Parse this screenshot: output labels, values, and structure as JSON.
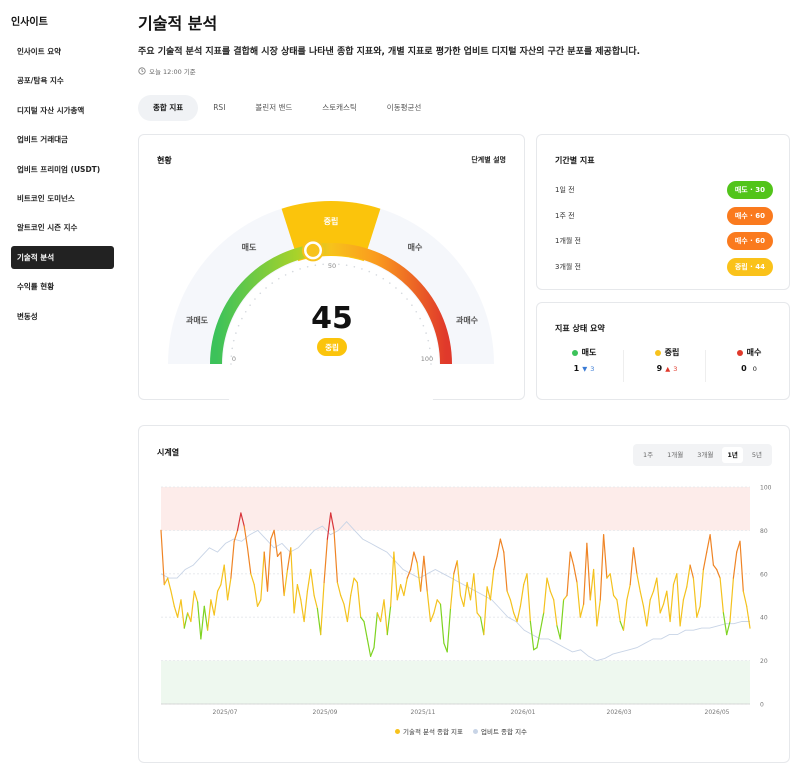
{
  "sidebar": {
    "title": "인사이트",
    "items": [
      {
        "label": "인사이트 요약"
      },
      {
        "label": "공포/탐욕 지수"
      },
      {
        "label": "디지털 자산 시가총액"
      },
      {
        "label": "업비트 거래대금"
      },
      {
        "label": "업비트 프리미엄 (USDT)"
      },
      {
        "label": "비트코인 도미넌스"
      },
      {
        "label": "알트코인 시즌 지수"
      },
      {
        "label": "기술적 분석"
      },
      {
        "label": "수익률 현황"
      },
      {
        "label": "변동성"
      }
    ],
    "active_index": 7
  },
  "header": {
    "title": "기술적 분석",
    "description": "주요 기술적 분석 지표를 결합해 시장 상태를 나타낸 종합 지표와, 개별 지표로 평가한 업비트 디지털 자산의 구간 분포를 제공합니다.",
    "timestamp": "오늘 12:00 기준"
  },
  "tabs": [
    {
      "label": "종합 지표"
    },
    {
      "label": "RSI"
    },
    {
      "label": "볼린저 밴드"
    },
    {
      "label": "스토캐스틱"
    },
    {
      "label": "이동평균선"
    }
  ],
  "gauge": {
    "title": "현황",
    "help_link": "단계별 설명",
    "value": "45",
    "status": "중립",
    "zone_labels": {
      "extreme_sell": "과매도",
      "sell": "매도",
      "neutral": "중립",
      "buy": "매수",
      "extreme_buy": "과매수"
    },
    "tick_min": "0",
    "tick_mid": "50",
    "tick_max": "100",
    "value_fraction": 0.45
  },
  "period": {
    "title": "기간별 지표",
    "rows": [
      {
        "label": "1일 전",
        "badge": "매도 · 30",
        "color": "#52c41a"
      },
      {
        "label": "1주 전",
        "badge": "매수 · 60",
        "color": "#fa7a1e"
      },
      {
        "label": "1개월 전",
        "badge": "매수 · 60",
        "color": "#fa7a1e"
      },
      {
        "label": "3개월 전",
        "badge": "중립 · 44",
        "color": "#fac21a"
      }
    ]
  },
  "summary": {
    "title": "지표 상태 요약",
    "columns": [
      {
        "label": "매도",
        "color": "#3cc25a",
        "count": "1",
        "arrow": "▼",
        "change": "3",
        "arrow_color": "#3a7bd5"
      },
      {
        "label": "중립",
        "color": "#f7c21c",
        "count": "9",
        "arrow": "▲",
        "change": "3",
        "arrow_color": "#e0392b"
      },
      {
        "label": "매수",
        "color": "#e0392b",
        "count": "0",
        "arrow": "",
        "change": "0",
        "arrow_color": "#111"
      }
    ]
  },
  "timeseries": {
    "title": "시계열",
    "ranges": [
      {
        "label": "1주"
      },
      {
        "label": "1개월"
      },
      {
        "label": "3개월"
      },
      {
        "label": "1년",
        "active": true
      },
      {
        "label": "5년"
      }
    ],
    "legend": [
      {
        "label": "기술적 분석 종합 지표",
        "color": "#f7c21c"
      },
      {
        "label": "업비트 종합 지수",
        "color": "#c8d4e6"
      }
    ]
  },
  "chart_data": {
    "type": "line",
    "ylim": [
      0,
      100
    ],
    "y_ticks": [
      "0",
      "20",
      "40",
      "60",
      "80",
      "100"
    ],
    "x_ticks": [
      "2025/07",
      "2025/09",
      "2025/11",
      "2026/01",
      "2026/03",
      "2026/05"
    ],
    "bands": [
      {
        "from": 80,
        "to": 100,
        "color": "#fdecea"
      },
      {
        "from": 0,
        "to": 20,
        "color": "#eef8ef"
      }
    ],
    "series": [
      {
        "name": "기술적 분석 종합 지표",
        "values": [
          80,
          55,
          58,
          52,
          45,
          40,
          48,
          35,
          42,
          38,
          52,
          47,
          30,
          45,
          34,
          48,
          41,
          52,
          55,
          64,
          48,
          58,
          75,
          80,
          88,
          82,
          72,
          60,
          55,
          45,
          48,
          70,
          52,
          76,
          80,
          68,
          70,
          50,
          62,
          72,
          42,
          55,
          48,
          38,
          52,
          62,
          50,
          44,
          32,
          56,
          76,
          88,
          80,
          56,
          50,
          46,
          38,
          50,
          58,
          56,
          40,
          38,
          30,
          22,
          26,
          42,
          38,
          48,
          32,
          45,
          70,
          48,
          55,
          50,
          58,
          62,
          70,
          65,
          52,
          68,
          52,
          38,
          42,
          48,
          46,
          28,
          24,
          44,
          60,
          66,
          50,
          45,
          56,
          48,
          60,
          42,
          40,
          32,
          54,
          48,
          62,
          68,
          76,
          70,
          52,
          48,
          42,
          38,
          45,
          55,
          60,
          38,
          25,
          26,
          34,
          42,
          58,
          52,
          48,
          36,
          30,
          48,
          50,
          70,
          64,
          56,
          40,
          46,
          74,
          48,
          62,
          36,
          48,
          78,
          58,
          60,
          50,
          48,
          38,
          34,
          48,
          55,
          72,
          60,
          52,
          45,
          36,
          48,
          52,
          58,
          42,
          46,
          52,
          38,
          55,
          60,
          36,
          48,
          54,
          64,
          58,
          40,
          45,
          62,
          70,
          78,
          64,
          62,
          58,
          42,
          32,
          38,
          58,
          70,
          75,
          52,
          45,
          35
        ],
        "color": "#f7c21c"
      },
      {
        "name": "업비트 종합 지수",
        "values": [
          60,
          58,
          58,
          62,
          64,
          68,
          72,
          70,
          74,
          76,
          75,
          78,
          80,
          76,
          72,
          74,
          70,
          72,
          76,
          80,
          82,
          78,
          80,
          84,
          80,
          76,
          74,
          72,
          70,
          66,
          62,
          60,
          58,
          60,
          62,
          60,
          58,
          56,
          54,
          52,
          50,
          48,
          44,
          40,
          38,
          34,
          32,
          30,
          30,
          28,
          26,
          24,
          25,
          22,
          20,
          21,
          23,
          24,
          25,
          26,
          28,
          30,
          30,
          32,
          32,
          34,
          34,
          35,
          35,
          36,
          37,
          37,
          38,
          38
        ]
      }
    ]
  }
}
